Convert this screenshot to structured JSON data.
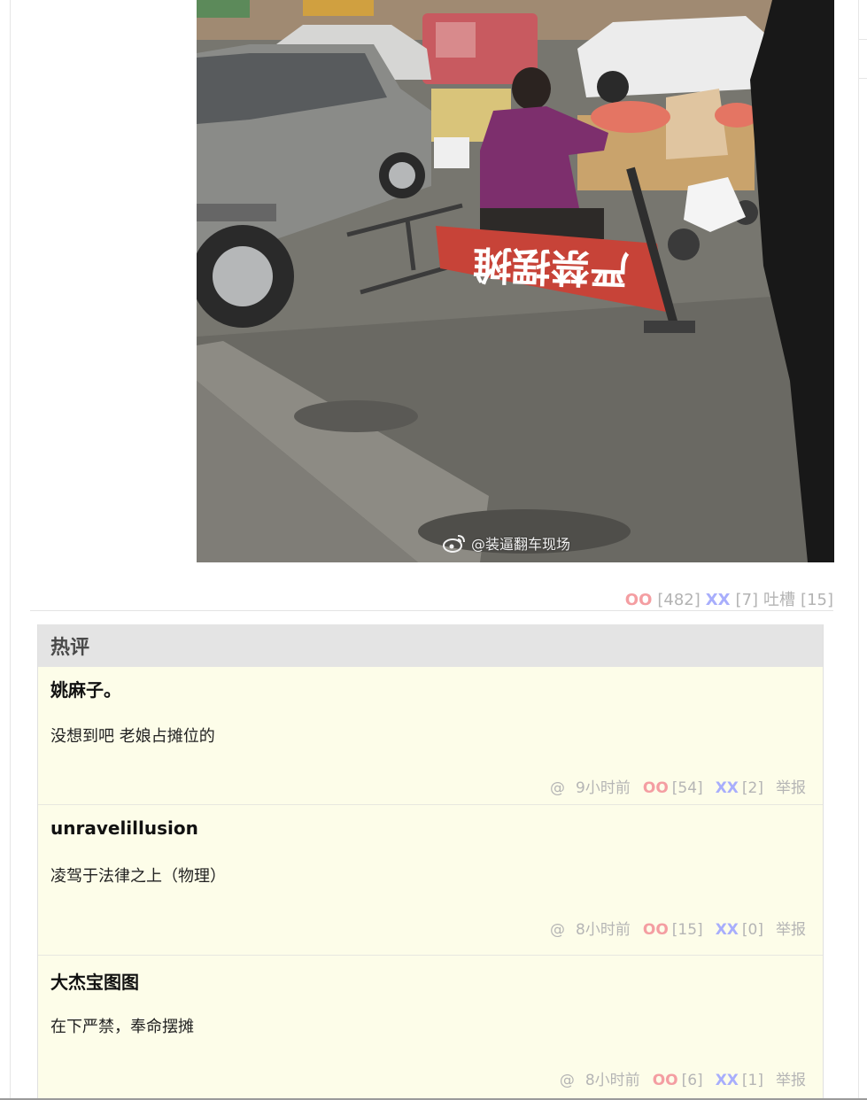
{
  "post": {
    "watermark": "@装逼翻车现场",
    "votes": {
      "oo_label": "OO",
      "oo_count": "[482]",
      "xx_label": "XX",
      "xx_count": "[7]",
      "tucao_label": "吐槽",
      "tucao_count": "[15]"
    },
    "sign_text": "严禁摆摊",
    "colors": {
      "oo": "#f49ea2",
      "xx": "#a8aefc",
      "panel_bg": "#fdfde9",
      "header_bg": "#e4e4e4"
    }
  },
  "hot": {
    "title": "热评",
    "comments": [
      {
        "author": "姚麻子。",
        "text": "没想到吧 老娘占摊位的",
        "at": "@",
        "time": "9小时前",
        "oo_label": "OO",
        "oo_count": "[54]",
        "xx_label": "XX",
        "xx_count": "[2]",
        "report": "举报"
      },
      {
        "author": "unravelillusion",
        "text": "凌驾于法律之上（物理）",
        "at": "@",
        "time": "8小时前",
        "oo_label": "OO",
        "oo_count": "[15]",
        "xx_label": "XX",
        "xx_count": "[0]",
        "report": "举报"
      },
      {
        "author": "大杰宝图图",
        "text": "在下严禁，奉命摆摊",
        "at": "@",
        "time": "8小时前",
        "oo_label": "OO",
        "oo_count": "[6]",
        "xx_label": "XX",
        "xx_count": "[1]",
        "report": "举报"
      }
    ]
  }
}
